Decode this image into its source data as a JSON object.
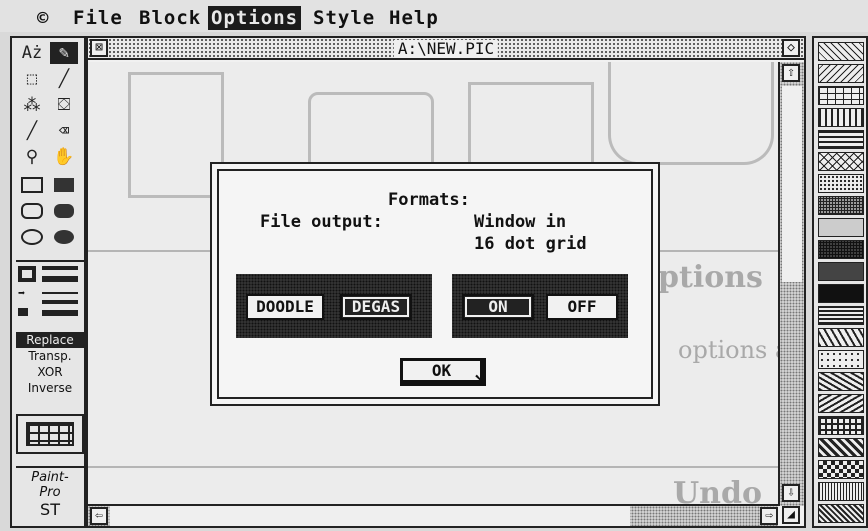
{
  "menubar": {
    "apple": "©",
    "items": [
      {
        "label": "File"
      },
      {
        "label": "Block"
      },
      {
        "label": "Options",
        "active": true
      },
      {
        "label": "Style"
      },
      {
        "label": "Help"
      }
    ]
  },
  "tools": {
    "modes": [
      "Replace",
      "Transp.",
      "XOR",
      "Inverse"
    ],
    "selected_mode": "Replace",
    "logo_lines": [
      "Paint-",
      "Pro",
      "ST"
    ]
  },
  "window": {
    "title": "A:\\NEW.PIC"
  },
  "background_doc": {
    "word1": "ptions",
    "line": "options allow you to vary the use of several of Pain",
    "word2": "Undo"
  },
  "dialog": {
    "heading": "Formats:",
    "file_output_label": "File output:",
    "window_label_line1": "Window in",
    "window_label_line2": "16 dot grid",
    "format_buttons": [
      {
        "label": "DOODLE",
        "selected": false
      },
      {
        "label": "DEGAS",
        "selected": true
      }
    ],
    "grid_buttons": [
      {
        "label": "ON",
        "selected": true
      },
      {
        "label": "OFF",
        "selected": false
      }
    ],
    "ok_label": "OK"
  },
  "colors": {
    "ink": "#111111",
    "paper": "#efefef",
    "selected": "#222222"
  }
}
